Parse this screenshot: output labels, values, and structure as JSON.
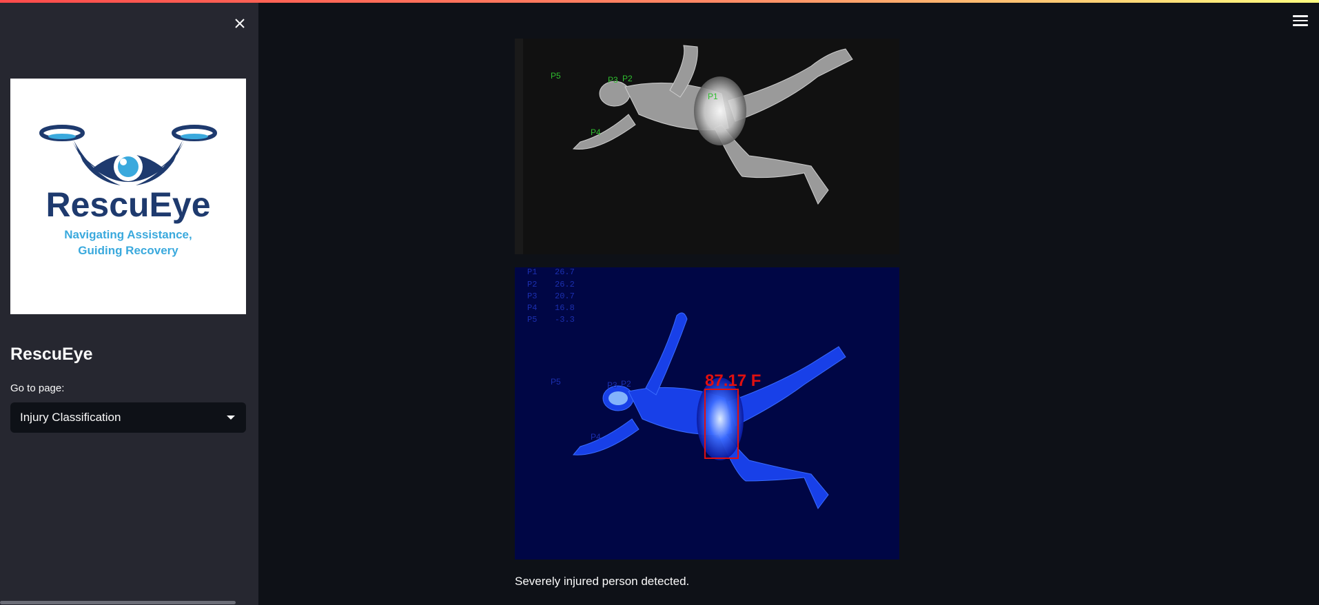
{
  "sidebar": {
    "logo": {
      "name": "RescuEye",
      "tagline_line1": "Navigating Assistance,",
      "tagline_line2": "Guiding Recovery"
    },
    "title": "RescuEye",
    "goto_label": "Go to page:",
    "page_select": {
      "selected": "Injury Classification"
    }
  },
  "main": {
    "gray_image": {
      "point_labels": [
        "P5",
        "P3",
        "P2",
        "P1",
        "P4"
      ]
    },
    "blue_image": {
      "readings": [
        {
          "label": "P1",
          "value": "26.7"
        },
        {
          "label": "P2",
          "value": "26.2"
        },
        {
          "label": "P3",
          "value": "20.7"
        },
        {
          "label": "P4",
          "value": "16.8"
        },
        {
          "label": "P5",
          "value": "-3.3"
        }
      ],
      "point_labels": [
        "P5",
        "P3",
        "P2",
        "P4"
      ],
      "temperature": "87.17 F"
    },
    "status": "Severely injured person detected."
  },
  "colors": {
    "sidebar_bg": "#262730",
    "main_bg": "#0e1117",
    "logo_dark": "#1e3a6e",
    "logo_light": "#3aa9dd",
    "detect_box": "#e01010",
    "point_label_green": "#2fbf2f"
  }
}
